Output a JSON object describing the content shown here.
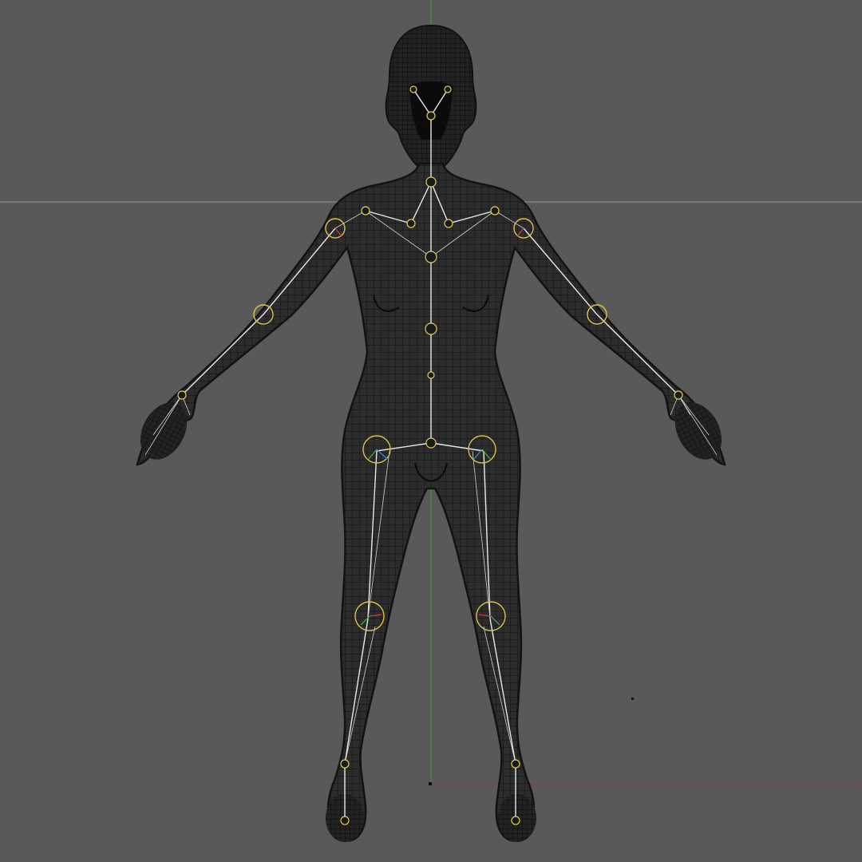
{
  "viewport": {
    "background_color": "#595959",
    "mesh_color": "#2a2a2a",
    "wire_color": "#151515",
    "bone_color": "#e8e8e8",
    "joint_color": "#d9c24a",
    "axis_colors": {
      "horizontal_grid": "#9a9a9a",
      "y_axis": "#3f9b3f",
      "x_axis": "#9b3f3f"
    }
  },
  "joints": {
    "names": [
      "eye-left",
      "eye-right",
      "head",
      "neck",
      "clavicle-left",
      "clavicle-right",
      "shoulder-left",
      "shoulder-right",
      "spine-upper",
      "spine-mid",
      "spine-lower",
      "pelvis",
      "elbow-left",
      "elbow-right",
      "wrist-left",
      "wrist-right",
      "hip-left",
      "hip-right",
      "knee-left",
      "knee-right",
      "ankle-left",
      "ankle-right",
      "toe-left",
      "toe-right"
    ]
  }
}
